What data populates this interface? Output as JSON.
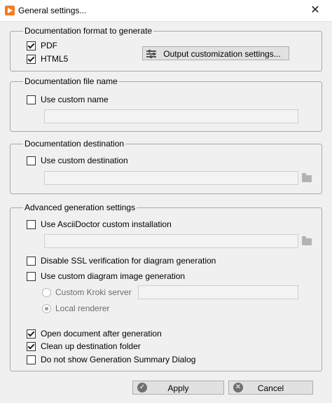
{
  "window": {
    "title": "General settings...",
    "close_glyph": "✕"
  },
  "format": {
    "legend": "Documentation format to generate",
    "pdf": {
      "label": "PDF",
      "checked": true
    },
    "html5": {
      "label": "HTML5",
      "checked": true
    },
    "output_button": "Output customization  settings..."
  },
  "file_name": {
    "legend": "Documentation file name",
    "use_custom": {
      "label": "Use custom name",
      "checked": false
    },
    "value": ""
  },
  "destination": {
    "legend": "Documentation destination",
    "use_custom": {
      "label": "Use custom destination",
      "checked": false
    },
    "value": ""
  },
  "advanced": {
    "legend": "Advanced generation settings",
    "asciidoctor": {
      "label": "Use AsciiDoctor custom installation",
      "checked": false
    },
    "asciidoctor_path": "",
    "disable_ssl": {
      "label": "Disable SSL verification for diagram generation",
      "checked": false
    },
    "custom_diagram": {
      "label": "Use custom diagram image generation",
      "checked": false
    },
    "kroki": {
      "label": "Custom Kroki server",
      "selected": false
    },
    "kroki_url": "",
    "local": {
      "label": "Local renderer",
      "selected": true
    },
    "open_after": {
      "label": "Open document after generation",
      "checked": true
    },
    "clean_up": {
      "label": "Clean up destination folder",
      "checked": true
    },
    "no_summary": {
      "label": "Do not show Generation Summary Dialog",
      "checked": false
    }
  },
  "buttons": {
    "apply": "Apply",
    "cancel": "Cancel",
    "apply_icon": "✓",
    "cancel_icon": "✕"
  }
}
